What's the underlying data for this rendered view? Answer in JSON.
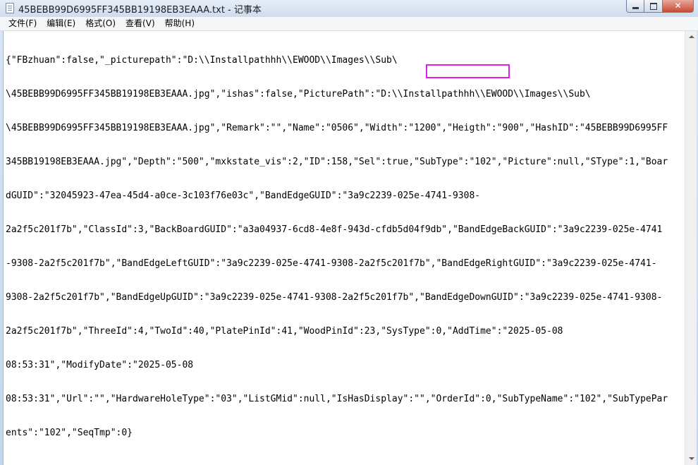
{
  "window": {
    "title": "45BEBB99D6995FF345BB19198EB3EAAA.txt - 记事本",
    "close_glyph": "✕"
  },
  "menu": [
    {
      "label": "文件(F)"
    },
    {
      "label": "编辑(E)"
    },
    {
      "label": "格式(O)"
    },
    {
      "label": "查看(V)"
    },
    {
      "label": "帮助(H)"
    }
  ],
  "document": {
    "lines": [
      "{\"FBzhuan\":false,\"_picturepath\":\"D:\\\\Installpathhh\\\\EWOOD\\\\Images\\\\Sub\\",
      "\\45BEBB99D6995FF345BB19198EB3EAAA.jpg\",\"ishas\":false,\"PicturePath\":\"D:\\\\Installpathhh\\\\EWOOD\\\\Images\\\\Sub\\",
      "\\45BEBB99D6995FF345BB19198EB3EAAA.jpg\",\"Remark\":\"\",\"Name\":\"0506\",\"Width\":\"1200\",\"Heigth\":\"900\",\"HashID\":\"45BEBB99D6995FF",
      "345BB19198EB3EAAA.jpg\",\"Depth\":\"500\",\"mxkstate_vis\":2,\"ID\":158,\"Sel\":true,\"SubType\":\"102\",\"Picture\":null,\"SType\":1,\"Boar",
      "dGUID\":\"32045923-47ea-45d4-a0ce-3c103f76e03c\",\"BandEdgeGUID\":\"3a9c2239-025e-4741-9308-",
      "2a2f5c201f7b\",\"ClassId\":3,\"BackBoardGUID\":\"a3a04937-6cd8-4e8f-943d-cfdb5d04f9db\",\"BandEdgeBackGUID\":\"3a9c2239-025e-4741",
      "-9308-2a2f5c201f7b\",\"BandEdgeLeftGUID\":\"3a9c2239-025e-4741-9308-2a2f5c201f7b\",\"BandEdgeRightGUID\":\"3a9c2239-025e-4741-",
      "9308-2a2f5c201f7b\",\"BandEdgeUpGUID\":\"3a9c2239-025e-4741-9308-2a2f5c201f7b\",\"BandEdgeDownGUID\":\"3a9c2239-025e-4741-9308-",
      "2a2f5c201f7b\",\"ThreeId\":4,\"TwoId\":40,\"PlatePinId\":41,\"WoodPinId\":23,\"SysType\":0,\"AddTime\":\"2025-05-08",
      "08:53:31\",\"ModifyDate\":\"2025-05-08",
      "08:53:31\",\"Url\":\"\",\"HardwareHoleType\":\"03\",\"ListGMid\":null,\"IsHasDisplay\":\"\",\"OrderId\":0,\"SubTypeName\":\"102\",\"SubTypePar",
      "ents\":\"102\",\"SeqTmp\":0}"
    ]
  },
  "colors": {
    "highlight": "#e020e0"
  }
}
